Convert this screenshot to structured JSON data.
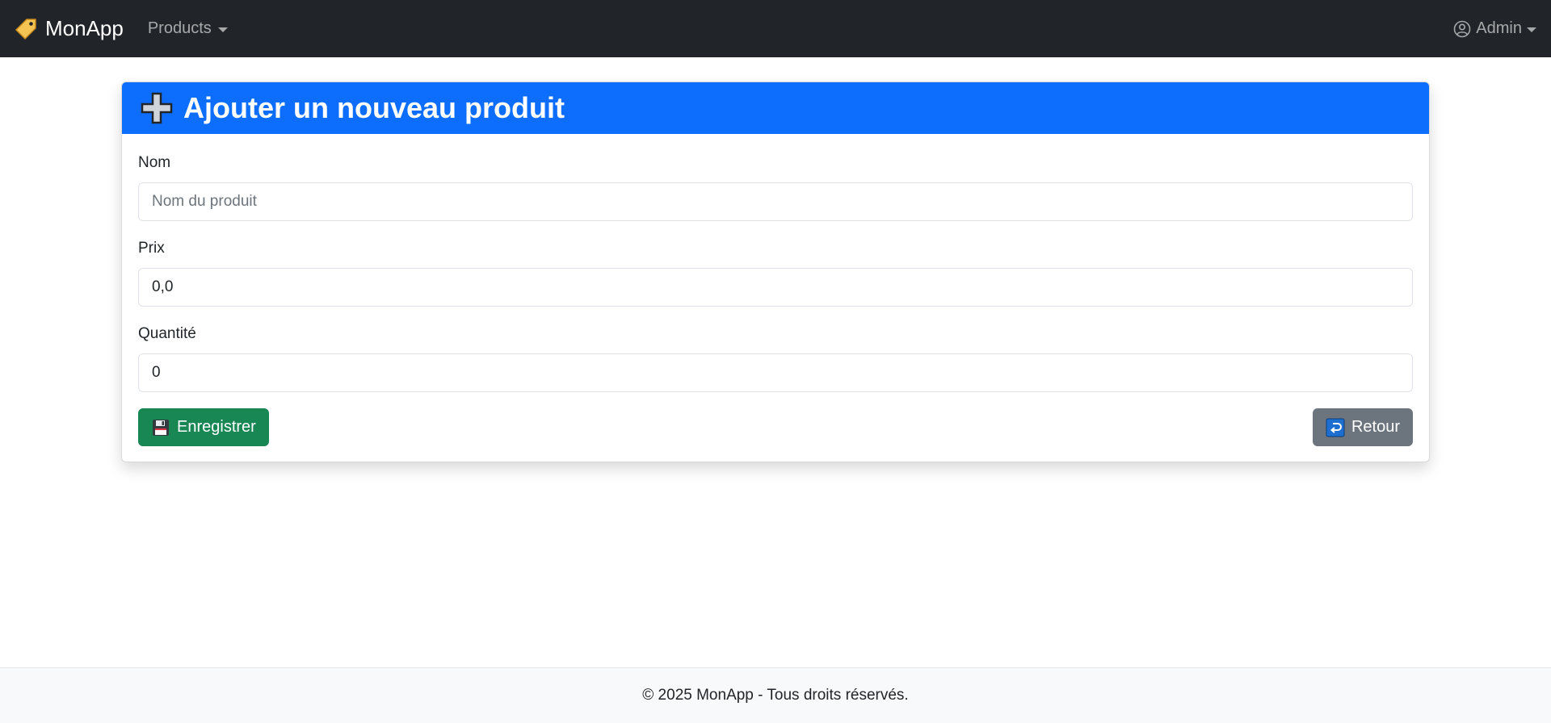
{
  "navbar": {
    "brand": "MonApp",
    "brand_icon": "price-tag-icon",
    "products_label": "Products",
    "admin_label": "Admin",
    "admin_icon": "user-circle-icon"
  },
  "card": {
    "title": "Ajouter un nouveau produit",
    "title_icon": "plus-icon",
    "accent_color": "#0d6efd"
  },
  "form": {
    "name": {
      "label": "Nom",
      "placeholder": "Nom du produit",
      "value": ""
    },
    "price": {
      "label": "Prix",
      "value": "0,0"
    },
    "quantity": {
      "label": "Quantité",
      "value": "0"
    }
  },
  "actions": {
    "save_label": "Enregistrer",
    "save_icon": "floppy-disk-icon",
    "save_color": "#198754",
    "back_label": "Retour",
    "back_icon": "return-arrow-icon",
    "back_color": "#6c757d"
  },
  "footer": {
    "text": "© 2025 MonApp - Tous droits réservés."
  }
}
